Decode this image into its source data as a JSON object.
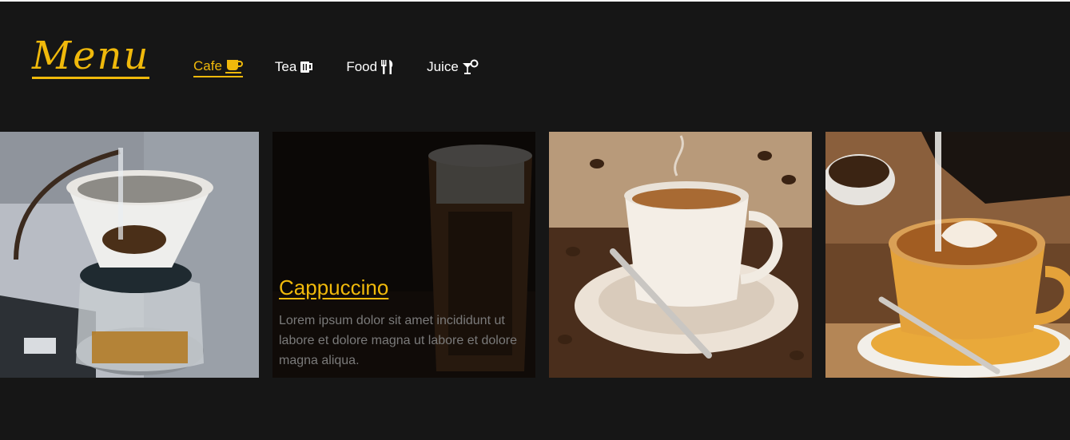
{
  "brand": {
    "title": "Menu"
  },
  "nav": {
    "items": [
      {
        "label": "Cafe",
        "icon": "coffee-cup-icon",
        "active": true
      },
      {
        "label": "Tea",
        "icon": "mug-icon",
        "active": false
      },
      {
        "label": "Food",
        "icon": "utensils-icon",
        "active": false
      },
      {
        "label": "Juice",
        "icon": "cocktail-icon",
        "active": false
      }
    ]
  },
  "gallery": {
    "cards": [
      {
        "image": "pour-over-coffee-photo"
      },
      {
        "image": "iced-coffee-photo",
        "title": "Cappuccino",
        "description": "Lorem ipsum dolor sit amet incididunt ut labore et dolore magna ut labore et dolore magna aliqua."
      },
      {
        "image": "coffee-cup-beans-photo"
      },
      {
        "image": "latte-art-photo"
      }
    ]
  },
  "colors": {
    "background": "#161616",
    "accent": "#f0b90b",
    "nav_text": "#ffffff",
    "muted_text": "#7a7a7a"
  }
}
